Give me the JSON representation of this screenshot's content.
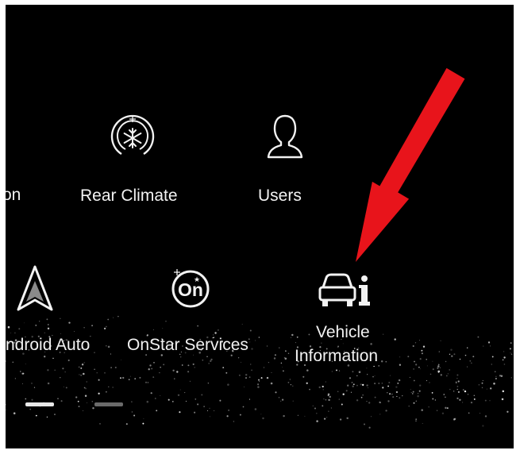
{
  "apps": {
    "row1": [
      {
        "id": "partial-left",
        "label": "on"
      },
      {
        "id": "rear-climate",
        "label": "Rear Climate",
        "icon": "rear-climate-icon"
      },
      {
        "id": "users",
        "label": "Users",
        "icon": "user-icon"
      }
    ],
    "row2": [
      {
        "id": "android-auto",
        "label": "ndroid Auto",
        "icon": "android-auto-icon"
      },
      {
        "id": "onstar-services",
        "label": "OnStar Services",
        "icon": "onstar-icon",
        "icon_text": "On"
      },
      {
        "id": "vehicle-information",
        "label_line1": "Vehicle",
        "label_line2": "Information",
        "icon": "vehicle-information-icon"
      }
    ]
  },
  "pager": {
    "page_count": 2,
    "active_page": 1
  },
  "colors": {
    "background": "#000000",
    "text": "#f2f2f2",
    "annotation_arrow": "#e8141b"
  }
}
